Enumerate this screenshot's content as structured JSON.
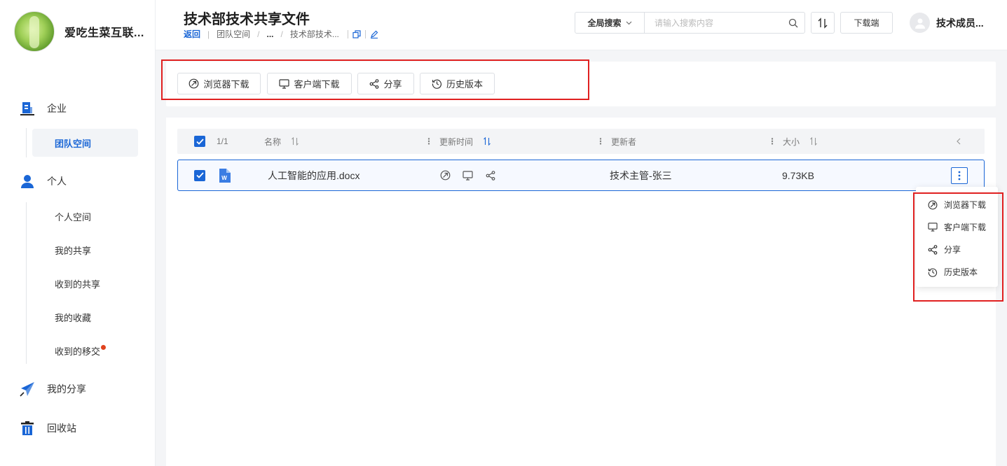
{
  "brand": {
    "name": "爱吃生菜互联..."
  },
  "sidebar": {
    "enterprise": {
      "label": "企业",
      "items": [
        {
          "label": "团队空间",
          "active": true
        }
      ]
    },
    "personal": {
      "label": "个人",
      "items": [
        {
          "label": "个人空间"
        },
        {
          "label": "我的共享"
        },
        {
          "label": "收到的共享"
        },
        {
          "label": "我的收藏"
        },
        {
          "label": "收到的移交",
          "badge_dot": true
        }
      ]
    },
    "my_share": {
      "label": "我的分享"
    },
    "recycle": {
      "label": "回收站"
    }
  },
  "header": {
    "title": "技术部技术共享文件",
    "breadcrumb": {
      "back": "返回",
      "team_space": "团队空间",
      "ellipsis": "...",
      "current": "技术部技术..."
    },
    "search": {
      "scope": "全局搜索",
      "placeholder": "请输入搜索内容"
    },
    "download_client": "下载端",
    "user": {
      "name": "技术成员..."
    }
  },
  "toolbar": {
    "browser_download": "浏览器下载",
    "client_download": "客户端下载",
    "share": "分享",
    "history": "历史版本"
  },
  "table": {
    "selection": "1/1",
    "columns": {
      "name": "名称",
      "updated_time": "更新时间",
      "updater": "更新者",
      "size": "大小"
    },
    "rows": [
      {
        "name": "人工智能的应用.docx",
        "updater": "技术主管-张三",
        "size": "9.73KB",
        "file_type": "word"
      }
    ]
  },
  "row_menu": {
    "items": [
      {
        "label": "浏览器下载",
        "icon": "browser-download-icon"
      },
      {
        "label": "客户端下载",
        "icon": "monitor-icon"
      },
      {
        "label": "分享",
        "icon": "share-icon"
      },
      {
        "label": "历史版本",
        "icon": "history-icon"
      }
    ]
  },
  "colors": {
    "accent": "#1a66d6",
    "highlight_box": "#e02020",
    "badge": "#e0431e"
  }
}
